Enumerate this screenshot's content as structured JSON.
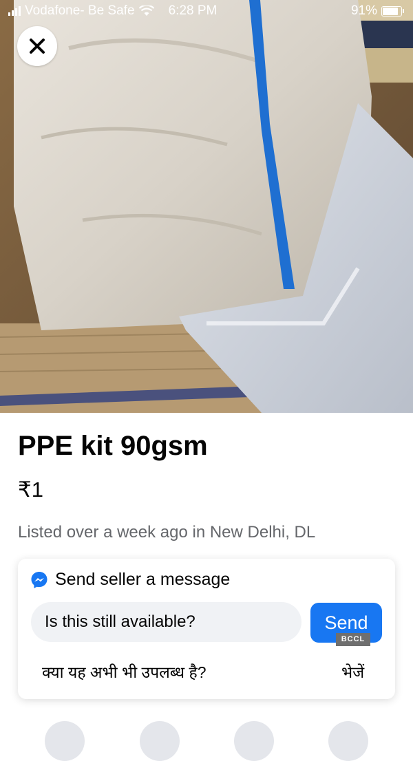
{
  "status_bar": {
    "carrier": "Vodafone- Be Safe",
    "time": "6:28 PM",
    "battery": "91%",
    "battery_level": 0.91,
    "icons": [
      "signal-icon",
      "wifi-icon",
      "battery-icon"
    ]
  },
  "photo": {
    "icon": "product-photo"
  },
  "close": {
    "icon": "close-icon"
  },
  "listing": {
    "title": "PPE kit 90gsm",
    "price": "₹1",
    "listed": "Listed over a week ago in New Delhi, DL"
  },
  "message_card": {
    "heading": "Send seller a message",
    "icon": "messenger-icon",
    "input_value": "Is this still available?",
    "send_label": "Send",
    "hindi_question": "क्या यह अभी भी उपलब्ध है?",
    "hindi_send": "भेजें"
  },
  "watermark": "BCCL",
  "colors": {
    "accent": "#1877f2",
    "input_bg": "#f0f2f5",
    "muted_text": "#65676b"
  }
}
